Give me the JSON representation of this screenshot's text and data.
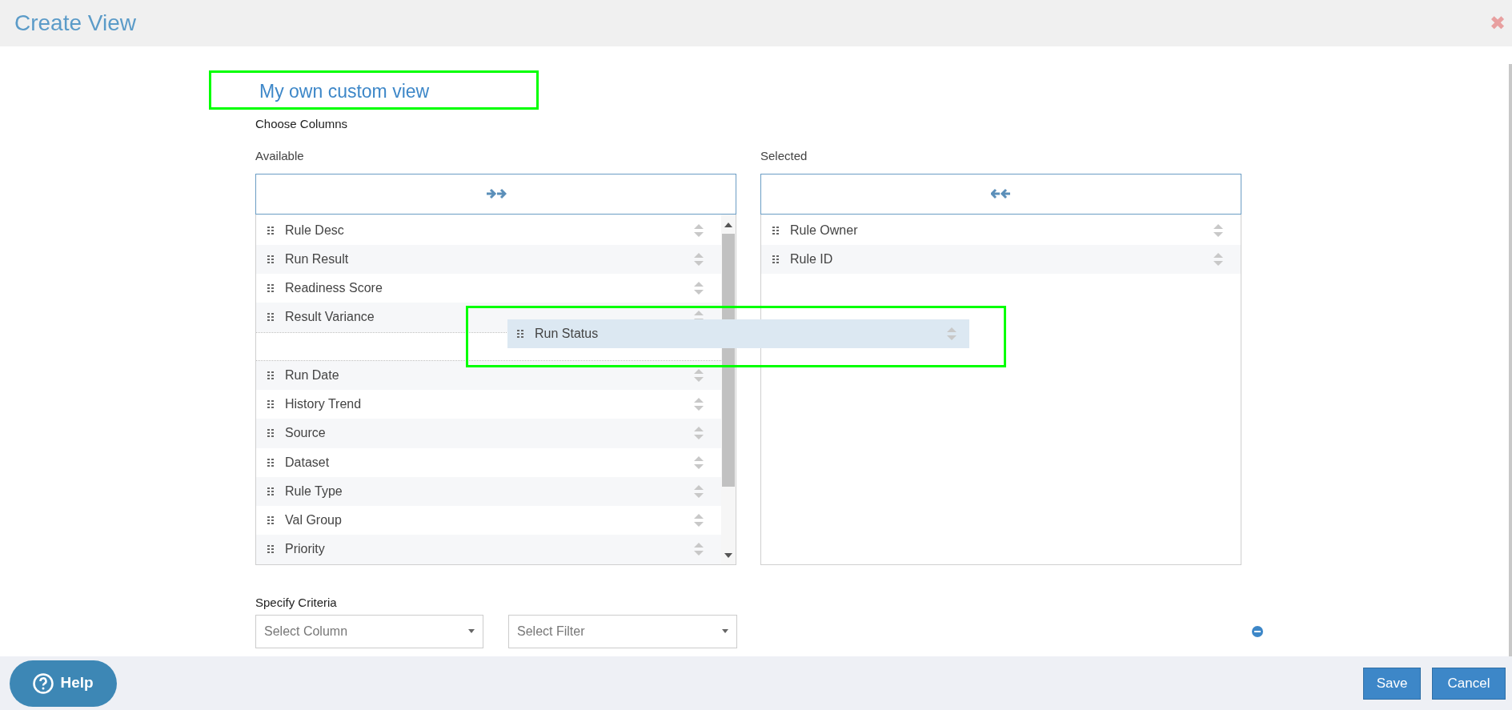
{
  "window": {
    "title": "Create View",
    "close": "✖"
  },
  "view_name": {
    "value": "My own custom view"
  },
  "choose_columns": {
    "heading": "Choose Columns",
    "available": {
      "label": "Available",
      "items": [
        {
          "kind": "column",
          "label": "Rule Desc"
        },
        {
          "kind": "column",
          "label": "Run Result"
        },
        {
          "kind": "column",
          "label": "Readiness Score"
        },
        {
          "kind": "column",
          "label": "Result Variance"
        },
        {
          "kind": "drop_slot"
        },
        {
          "kind": "column",
          "label": "Run Date"
        },
        {
          "kind": "column",
          "label": "History Trend"
        },
        {
          "kind": "column",
          "label": "Source"
        },
        {
          "kind": "column",
          "label": "Dataset"
        },
        {
          "kind": "column",
          "label": "Rule Type"
        },
        {
          "kind": "column",
          "label": "Val Group"
        },
        {
          "kind": "column",
          "label": "Priority"
        }
      ]
    },
    "selected": {
      "label": "Selected",
      "items": [
        {
          "kind": "column",
          "label": "Rule Owner"
        },
        {
          "kind": "column",
          "label": "Rule ID"
        }
      ]
    },
    "dragging": {
      "label": "Run Status"
    }
  },
  "criteria": {
    "heading": "Specify Criteria",
    "column_select": {
      "placeholder": "Select Column"
    },
    "filter_select": {
      "placeholder": "Select Filter"
    }
  },
  "footer": {
    "help": "Help",
    "buttons": [
      "Save",
      "Cancel"
    ]
  }
}
